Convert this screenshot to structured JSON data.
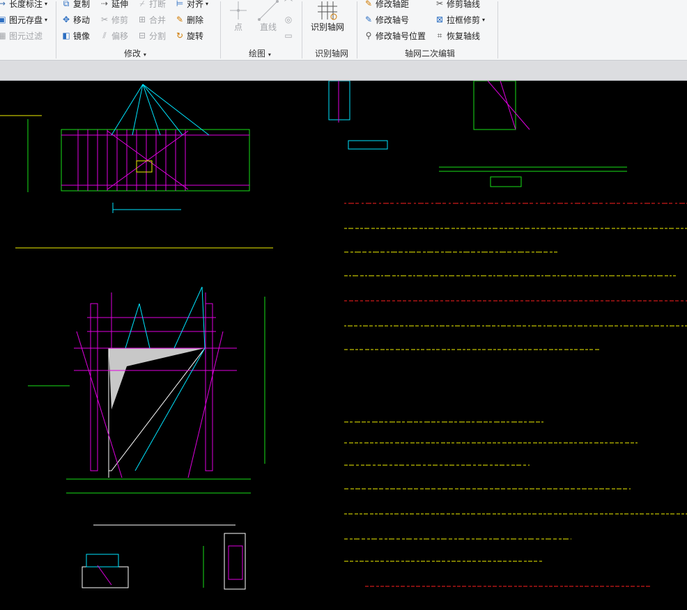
{
  "ribbon": {
    "col1": [
      "长度标注",
      "图元存盘",
      "图元过滤"
    ],
    "col2": [
      "复制",
      "移动",
      "镜像"
    ],
    "col3": [
      "延伸",
      "修剪",
      "偏移"
    ],
    "col4": [
      "打断",
      "合并",
      "分割"
    ],
    "col5": [
      "对齐",
      "删除",
      "旋转"
    ],
    "draw": [
      "点",
      "直线"
    ],
    "identify_button": "识别轴网",
    "axis_col1": [
      "修改轴距",
      "修改轴号",
      "修改轴号位置"
    ],
    "axis_col2": [
      "修剪轴线",
      "拉框修剪",
      "恢复轴线"
    ],
    "groups": {
      "modify": "修改",
      "draw": "绘图",
      "identify": "识别轴网",
      "axis_edit": "轴网二次编辑"
    }
  },
  "colors": {
    "cad_background": "#000000",
    "cyan": "#00e5ff",
    "magenta": "#e000e0",
    "green": "#18e018",
    "yellow": "#f0f000",
    "red": "#ff2020",
    "white": "#ffffff",
    "ribbon_bg": "#f5f6f7"
  }
}
